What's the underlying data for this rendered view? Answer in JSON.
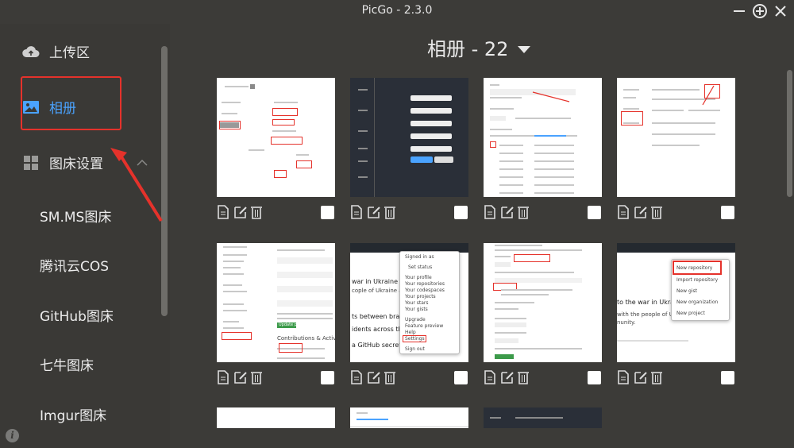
{
  "window": {
    "title": "PicGo - 2.3.0"
  },
  "sidebar": {
    "upload": "上传区",
    "gallery": "相册",
    "settings": "图床设置",
    "sub_items": [
      "SM.MS图床",
      "腾讯云COS",
      "GitHub图床",
      "七牛图床",
      "Imgur图床"
    ]
  },
  "main": {
    "album_label": "相册 - 22"
  },
  "thumb_text": {
    "t6_menu": [
      "Signed in as",
      "Set status",
      "Your profile",
      "Your repositories",
      "Your codespaces",
      "Your projects",
      "Your stars",
      "Your gists",
      "Upgrade",
      "Feature preview",
      "Help",
      "Settings",
      "Sign out"
    ],
    "t6_side": [
      "war in Ukraine",
      "cople of Ukraine and th",
      "ts between branches",
      "idents across the",
      "a GitHub secret"
    ],
    "t8_menu": [
      "New repository",
      "Import repository",
      "New gist",
      "New organization",
      "New project"
    ],
    "t8_side": [
      "to the war in Ukraine",
      "with the people of Ukraine a",
      "nunity."
    ],
    "t5_side": [
      "Contributions & Activity",
      "Update profile"
    ]
  },
  "colors": {
    "accent": "#4aa3ff",
    "annotation_red": "#e5322b",
    "bg": "#3c3b38"
  }
}
